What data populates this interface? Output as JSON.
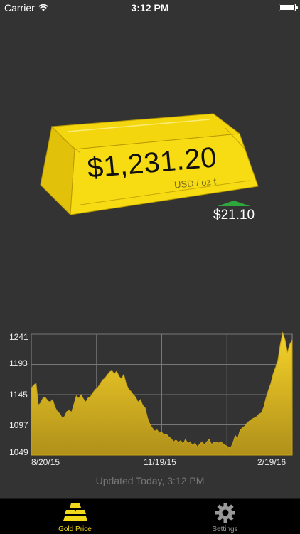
{
  "status_bar": {
    "carrier": "Carrier",
    "time": "3:12 PM"
  },
  "price": {
    "value": "$1,231.20",
    "unit": "USD / oz t",
    "change": "$21.10",
    "change_direction": "up",
    "change_color": "#2ea83a"
  },
  "colors": {
    "gold": "#f3d40f",
    "background": "#333333",
    "accent": "#f2d91a"
  },
  "chart_data": {
    "type": "area",
    "y_ticks": [
      "1241",
      "1193",
      "1145",
      "1097",
      "1049"
    ],
    "x_ticks": [
      "8/20/15",
      "11/19/15",
      "2/19/16"
    ],
    "ylim": [
      1049,
      1241
    ],
    "grid": true,
    "series": [
      {
        "values": [
          1155,
          1160,
          1163,
          1128,
          1132,
          1140,
          1140,
          1135,
          1133,
          1137,
          1125,
          1118,
          1115,
          1108,
          1110,
          1118,
          1120,
          1117,
          1130,
          1143,
          1139,
          1145,
          1138,
          1133,
          1140,
          1142,
          1148,
          1153,
          1156,
          1162,
          1168,
          1171,
          1176,
          1181,
          1183,
          1178,
          1182,
          1174,
          1170,
          1177,
          1162,
          1154,
          1150,
          1145,
          1141,
          1133,
          1137,
          1128,
          1124,
          1108,
          1098,
          1092,
          1087,
          1089,
          1084,
          1085,
          1081,
          1082,
          1078,
          1075,
          1070,
          1073,
          1069,
          1072,
          1066,
          1074,
          1067,
          1070,
          1064,
          1068,
          1062,
          1066,
          1070,
          1065,
          1070,
          1074,
          1066,
          1069,
          1070,
          1068,
          1070,
          1066,
          1064,
          1062,
          1060,
          1068,
          1080,
          1075,
          1088,
          1092,
          1095,
          1100,
          1103,
          1106,
          1108,
          1110,
          1114,
          1116,
          1125,
          1140,
          1152,
          1163,
          1178,
          1188,
          1200,
          1225,
          1243,
          1232,
          1212,
          1225,
          1232
        ]
      }
    ]
  },
  "updated_text": "Updated Today, 3:12 PM",
  "tabs": [
    {
      "label": "Gold Price",
      "icon": "gold-bars-icon",
      "active": true
    },
    {
      "label": "Settings",
      "icon": "gear-icon",
      "active": false
    }
  ]
}
